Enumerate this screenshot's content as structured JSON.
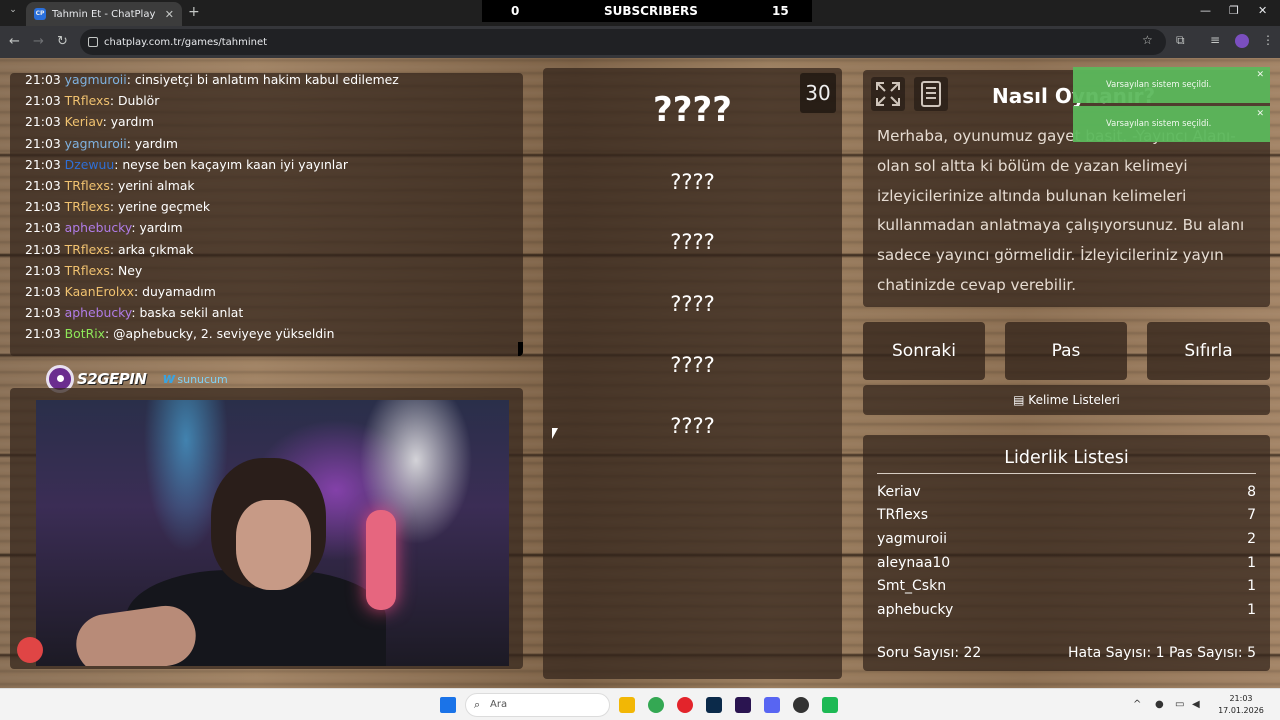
{
  "browser": {
    "tab_title": "Tahmin Et - ChatPlay",
    "tab_favicon": "CP",
    "url": "chatplay.com.tr/games/tahminet"
  },
  "overlay_bar": {
    "left_count": "0",
    "label": "SUBSCRIBERS",
    "right_count": "15"
  },
  "chat": {
    "partial_top_line": {
      "time": "21:03",
      "user": "yagmuroii",
      "color": "#7fb2e0",
      "text": "cinsiyetçi bi anlatım hakim kabul edilemez"
    },
    "messages": [
      {
        "time": "21:03",
        "user": "TRflexs",
        "color": "#f0c270",
        "text": "Dublör"
      },
      {
        "time": "21:03",
        "user": "Keriav",
        "color": "#f0c270",
        "text": "yardım"
      },
      {
        "time": "21:03",
        "user": "yagmuroii",
        "color": "#7fb2e0",
        "text": "yardım"
      },
      {
        "time": "21:03",
        "user": "Dzewuu",
        "color": "#2f6fd6",
        "text": "neyse ben kaçayım kaan iyi yayınlar"
      },
      {
        "time": "21:03",
        "user": "TRflexs",
        "color": "#f0c270",
        "text": "yerini almak"
      },
      {
        "time": "21:03",
        "user": "TRflexs",
        "color": "#f0c270",
        "text": "yerine geçmek"
      },
      {
        "time": "21:03",
        "user": "aphebucky",
        "color": "#b07ce6",
        "text": "yardım"
      },
      {
        "time": "21:03",
        "user": "TRflexs",
        "color": "#f0c270",
        "text": "arka çıkmak"
      },
      {
        "time": "21:03",
        "user": "TRflexs",
        "color": "#f0c270",
        "text": "Ney"
      },
      {
        "time": "21:03",
        "user": "KaanErolxx",
        "color": "#f0c270",
        "text": "duyamadım"
      },
      {
        "time": "21:03",
        "user": "aphebucky",
        "color": "#b07ce6",
        "text": "baska sekil anlat"
      },
      {
        "time": "21:03",
        "user": "BotRix",
        "color": "#8fe85a",
        "text": "@aphebucky, 2. seviyeye yükseldin"
      }
    ]
  },
  "sponsors": {
    "s2g": "S2GEPIN",
    "sunucum_prefix": "w",
    "sunucum": "sunucum"
  },
  "game": {
    "timer": "30",
    "main_word": "????",
    "hidden_words": [
      "????",
      "????",
      "????",
      "????",
      "????"
    ]
  },
  "howto": {
    "title": "Nasıl Oynanır?",
    "text": "Merhaba, oyunumuz gayet basit. -Yayıncı Alanı- olan sol altta ki bölüm de yazan kelimeyi izleyicilerinize altında bulunan kelimeleri kullanmadan anlatmaya çalışıyorsunuz. Bu alanı sadece yayıncı görmelidir. İzleyicileriniz yayın chatinizde cevap verebilir."
  },
  "actions": {
    "next": "Sonraki",
    "pass": "Pas",
    "reset": "Sıfırla",
    "word_lists": "Kelime Listeleri"
  },
  "leaderboard": {
    "title": "Liderlik Listesi",
    "rows": [
      {
        "name": "Keriav",
        "score": "8"
      },
      {
        "name": "TRflexs",
        "score": "7"
      },
      {
        "name": "yagmuroii",
        "score": "2"
      },
      {
        "name": "aleynaa10",
        "score": "1"
      },
      {
        "name": "Smt_Cskn",
        "score": "1"
      },
      {
        "name": "aphebucky",
        "score": "1"
      }
    ],
    "questions": "Soru Sayısı: 22",
    "errors": "Hata Sayısı: 1",
    "passes": "Pas Sayısı: 5"
  },
  "toasts": [
    "Varsayılan sistem seçildi.",
    "Varsayılan sistem seçildi."
  ],
  "taskbar": {
    "search_placeholder": "Ara",
    "time": "21:03",
    "date": "17.01.2026"
  },
  "colors": {
    "toast_green": "#5cb85c",
    "panel": "#34261c"
  }
}
